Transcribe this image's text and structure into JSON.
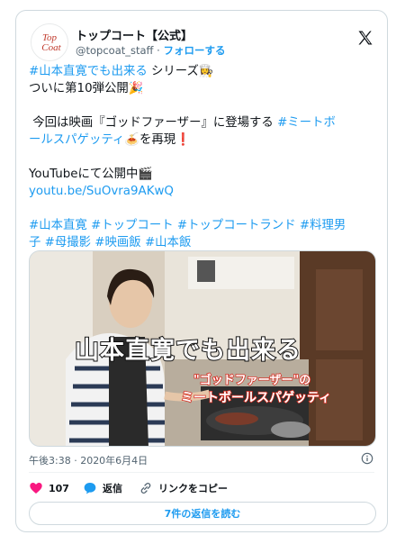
{
  "account": {
    "name": "トップコート【公式】",
    "handle": "@topcoat_staff",
    "separator": "·",
    "follow_label": "フォローする",
    "avatar_text_line1": "Top",
    "avatar_text_line2": "Coat"
  },
  "tweet": {
    "line1_tag": "#山本直寛でも出来る",
    "line1_rest": " シリーズ👩‍🍳",
    "line2": "ついに第10弾公開🎉",
    "line3_pre": " 今回は映画『ゴッドファーザー』に登場する ",
    "line3_tag": "#ミートボ",
    "line4_tag": "ールスパゲッティ",
    "line4_rest": "🍝を再現❗",
    "line5": "YouTubeにて公開中🎬",
    "line6_link": "youtu.be/SuOvra9AKwQ",
    "hashtags_line1": "#山本直寛 #トップコート #トップコートランド #料理男",
    "hashtags_line2": "子 #母撮影 #映画飯 #山本飯"
  },
  "media": {
    "overlay_title": "山本直寛でも出来る",
    "overlay_sub1": "\"ゴッドファーザー\"の",
    "overlay_sub2": "ミートボールスパゲッティ"
  },
  "meta": {
    "timestamp": "午後3:38 · 2020年6月4日"
  },
  "actions": {
    "like_count": "107",
    "reply_label": "返信",
    "copy_link_label": "リンクをコピー"
  },
  "footer": {
    "read_replies_label": "7件の返信を読む"
  },
  "colors": {
    "link": "#1d9bf0",
    "like": "#f91880",
    "text": "#0f1419",
    "muted": "#536471"
  }
}
